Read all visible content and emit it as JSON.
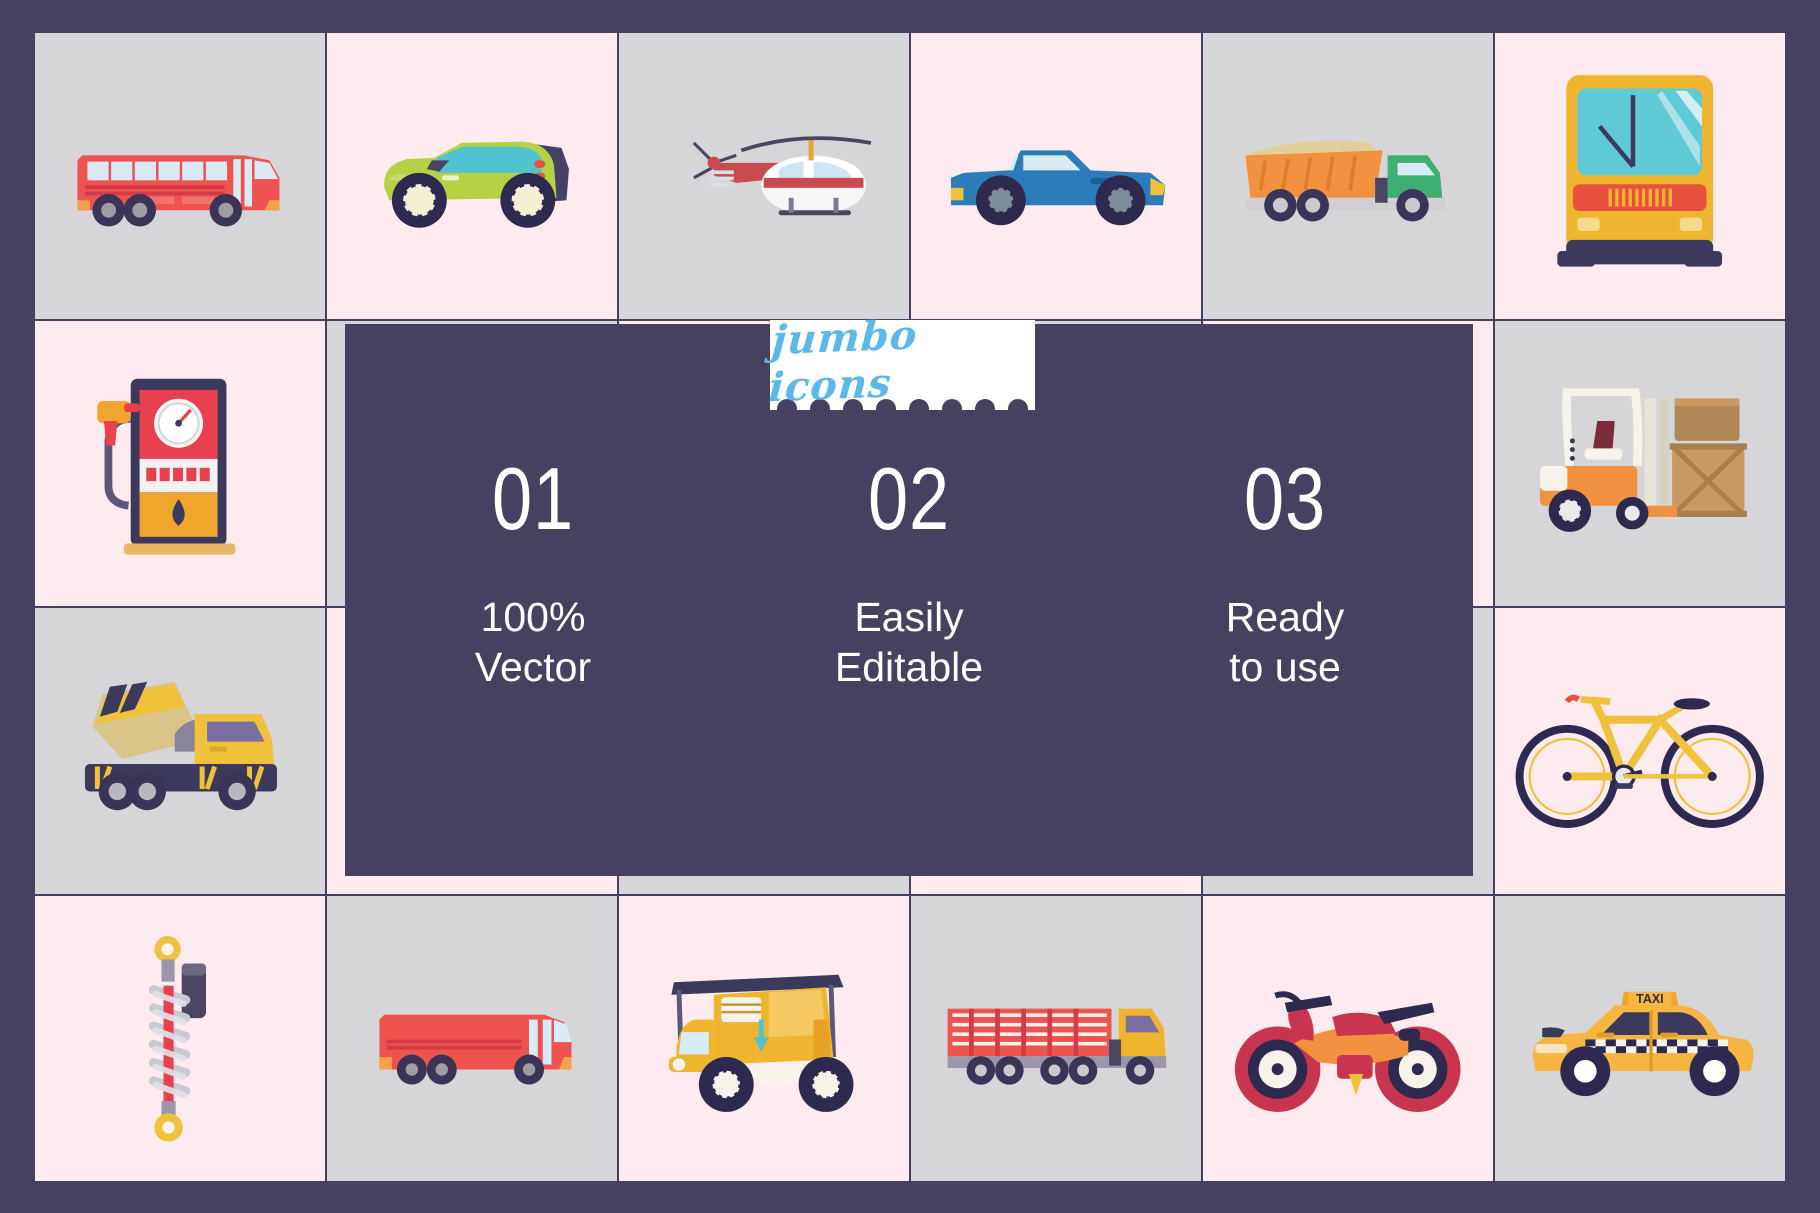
{
  "brand": {
    "tag_label": "jumbo icons"
  },
  "colors": {
    "frame": "#464161",
    "panel": "#464161",
    "tile_gray": "#d6d6d8",
    "tile_pink": "#fdebef",
    "tag_text": "#5bb8e8",
    "feature_text": "#ffffff"
  },
  "features": [
    {
      "number": "01",
      "caption": "100%\nVector"
    },
    {
      "number": "02",
      "caption": "Easily\nEditable"
    },
    {
      "number": "03",
      "caption": "Ready\nto use"
    }
  ],
  "tiles": [
    {
      "icon": "bus-icon",
      "label": "Bus",
      "bg": "gray"
    },
    {
      "icon": "compact-car-icon",
      "label": "Compact Car",
      "bg": "pink"
    },
    {
      "icon": "helicopter-icon",
      "label": "Helicopter",
      "bg": "gray"
    },
    {
      "icon": "pickup-truck-icon",
      "label": "Pickup Truck",
      "bg": "pink"
    },
    {
      "icon": "dump-truck-icon",
      "label": "Dump Truck",
      "bg": "gray"
    },
    {
      "icon": "bus-front-icon",
      "label": "Bus Front View",
      "bg": "pink"
    },
    {
      "icon": "fuel-pump-icon",
      "label": "Fuel Pump",
      "bg": "pink"
    },
    {
      "icon": "panel-cell-icon",
      "label": "",
      "bg": "gray"
    },
    {
      "icon": "panel-cell-icon",
      "label": "",
      "bg": "pink"
    },
    {
      "icon": "panel-cell-icon",
      "label": "",
      "bg": "gray"
    },
    {
      "icon": "panel-cell-icon",
      "label": "",
      "bg": "pink"
    },
    {
      "icon": "forklift-icon",
      "label": "Forklift",
      "bg": "gray"
    },
    {
      "icon": "cement-mixer-icon",
      "label": "Cement Mixer Truck",
      "bg": "gray"
    },
    {
      "icon": "panel-cell-icon",
      "label": "",
      "bg": "pink"
    },
    {
      "icon": "panel-cell-icon",
      "label": "",
      "bg": "gray"
    },
    {
      "icon": "panel-cell-icon",
      "label": "",
      "bg": "pink"
    },
    {
      "icon": "panel-cell-icon",
      "label": "",
      "bg": "gray"
    },
    {
      "icon": "bicycle-icon",
      "label": "Bicycle",
      "bg": "pink"
    },
    {
      "icon": "shock-absorber-icon",
      "label": "Shock Absorber",
      "bg": "pink"
    },
    {
      "icon": "bus-small-icon",
      "label": "Coach Bus",
      "bg": "gray"
    },
    {
      "icon": "tuktuk-icon",
      "label": "Tuk Tuk",
      "bg": "pink"
    },
    {
      "icon": "cargo-truck-icon",
      "label": "Cargo Truck",
      "bg": "gray"
    },
    {
      "icon": "motorcycle-icon",
      "label": "Motorcycle",
      "bg": "pink"
    },
    {
      "icon": "taxi-icon",
      "label": "Taxi",
      "bg": "gray"
    }
  ],
  "taxi": {
    "sign_label": "TAXI"
  }
}
